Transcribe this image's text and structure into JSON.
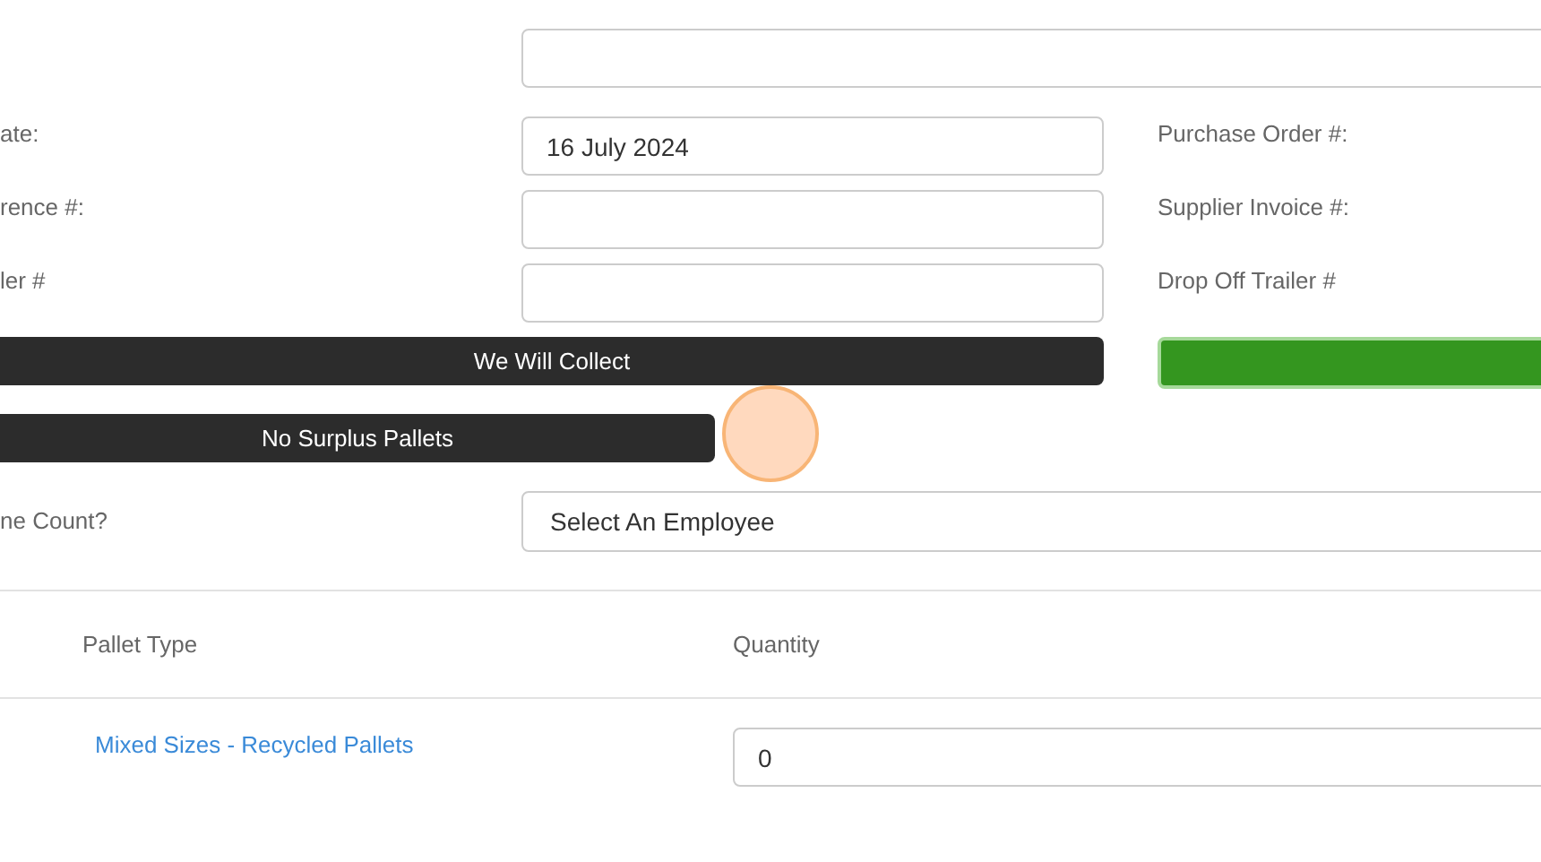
{
  "rows": [
    {
      "label": "ate:",
      "value": "16 July 2024",
      "right_label": "Purchase Order #:"
    },
    {
      "label": "rence #:",
      "right_label": "Supplier Invoice #:"
    },
    {
      "label": "ler #",
      "right_label": "Drop Off Trailer #"
    }
  ],
  "collect_button": {
    "label": "We Will Collect"
  },
  "surplus_button": {
    "label": "No Surplus Pallets"
  },
  "employee": {
    "label": "ne Count?",
    "value": "Select An Employee"
  },
  "table": {
    "columns": [
      "Pallet Type",
      "Quantity"
    ],
    "rows": [
      {
        "pallet_type": "Mixed Sizes - Recycled Pallets",
        "quantity": "0"
      }
    ]
  }
}
